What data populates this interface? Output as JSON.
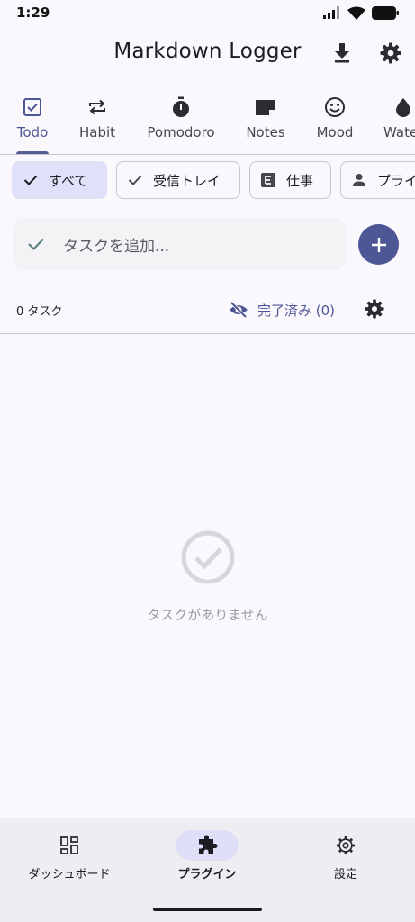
{
  "status_bar": {
    "time": "1:29"
  },
  "app_bar": {
    "title": "Markdown Logger"
  },
  "tabs": [
    {
      "label": "Todo",
      "icon": "checkbox-icon",
      "active": true
    },
    {
      "label": "Habit",
      "icon": "repeat-icon"
    },
    {
      "label": "Pomodoro",
      "icon": "timer-icon"
    },
    {
      "label": "Notes",
      "icon": "note-icon"
    },
    {
      "label": "Mood",
      "icon": "smiley-icon"
    },
    {
      "label": "Water",
      "icon": "drop-icon"
    }
  ],
  "chips": [
    {
      "label": "すべて",
      "icon": "check-icon",
      "selected": true
    },
    {
      "label": "受信トレイ",
      "icon": "check-icon"
    },
    {
      "label": "仕事",
      "icon": "letter-e-icon"
    },
    {
      "label": "プライベート",
      "icon": "person-icon"
    }
  ],
  "add_task": {
    "placeholder": "タスクを追加..."
  },
  "summary": {
    "task_count": "0 タスク",
    "completed_label": "完了済み (0)"
  },
  "empty_state": {
    "message": "タスクがありません"
  },
  "bottom_nav": [
    {
      "label": "ダッシュボード",
      "icon": "dashboard-icon"
    },
    {
      "label": "プラグイン",
      "icon": "puzzle-icon",
      "active": true
    },
    {
      "label": "設定",
      "icon": "gear-icon"
    }
  ],
  "colors": {
    "primary": "#4e5795",
    "background": "#fbf8fd",
    "chip_selected": "#e0e0f9",
    "nav_background": "#efedf1"
  }
}
